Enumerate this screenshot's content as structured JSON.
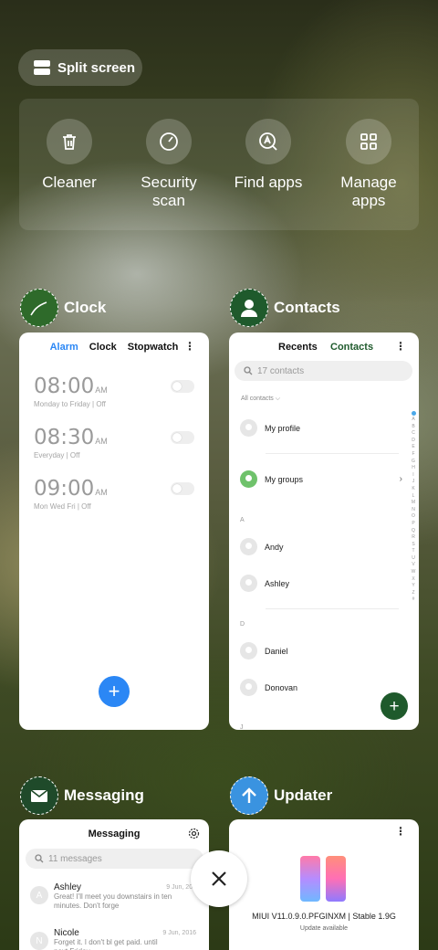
{
  "split_screen": {
    "label": "Split screen",
    "icon": "split-screen-icon"
  },
  "quick_actions": [
    {
      "label": "Cleaner",
      "icon": "trash-icon"
    },
    {
      "label": "Security\nscan",
      "icon": "security-scan-icon"
    },
    {
      "label": "Find apps",
      "icon": "find-apps-icon"
    },
    {
      "label": "Manage\napps",
      "icon": "grid-apps-icon"
    }
  ],
  "apps": {
    "clock": {
      "name": "Clock",
      "tabs": [
        "Alarm",
        "Clock",
        "Stopwatch"
      ],
      "alarms": [
        {
          "time": "08:00",
          "ampm": "AM",
          "repeat": "Monday to Friday",
          "state": "Off"
        },
        {
          "time": "08:30",
          "ampm": "AM",
          "repeat": "Everyday",
          "state": "Off"
        },
        {
          "time": "09:00",
          "ampm": "AM",
          "repeat": "Mon Wed Fri",
          "state": "Off"
        }
      ],
      "fab": "+"
    },
    "contacts": {
      "name": "Contacts",
      "tabs": [
        "Recents",
        "Contacts"
      ],
      "search_placeholder": "17 contacts",
      "filter": "All contacts",
      "my_profile": "My profile",
      "my_groups": "My groups",
      "sections": [
        {
          "letter": "A",
          "names": [
            "Andy",
            "Ashley"
          ]
        },
        {
          "letter": "D",
          "names": [
            "Daniel",
            "Donovan"
          ]
        }
      ],
      "next_letter": "J",
      "index": [
        "A",
        "B",
        "C",
        "D",
        "E",
        "F",
        "G",
        "H",
        "I",
        "J",
        "K",
        "L",
        "M",
        "N",
        "O",
        "P",
        "Q",
        "R",
        "S",
        "T",
        "U",
        "V",
        "W",
        "X",
        "Y",
        "Z",
        "#"
      ],
      "fab": "+",
      "accent": "#1f5a2c"
    },
    "messaging": {
      "name": "Messaging",
      "title": "Messaging",
      "search_placeholder": "11 messages",
      "threads": [
        {
          "initial": "A",
          "name": "Ashley",
          "date": "9 Jun, 201",
          "text": "Great! I'll meet you downstairs in ten minutes. Don't forge"
        },
        {
          "initial": "N",
          "name": "Nicole",
          "date": "9 Jun, 2016",
          "text": "Forget it. I don't bl get paid. until next Friday."
        }
      ]
    },
    "updater": {
      "name": "Updater",
      "version": "MIUI V11.0.9.0.PFGINXM | Stable 1.9G",
      "status": "Update available",
      "logo": "11"
    }
  },
  "close_button": {
    "icon": "close-icon"
  },
  "colors": {
    "accent_blue": "#2b87f5",
    "contacts_green": "#1f5a2c",
    "fab_blue": "#2b87f5"
  }
}
